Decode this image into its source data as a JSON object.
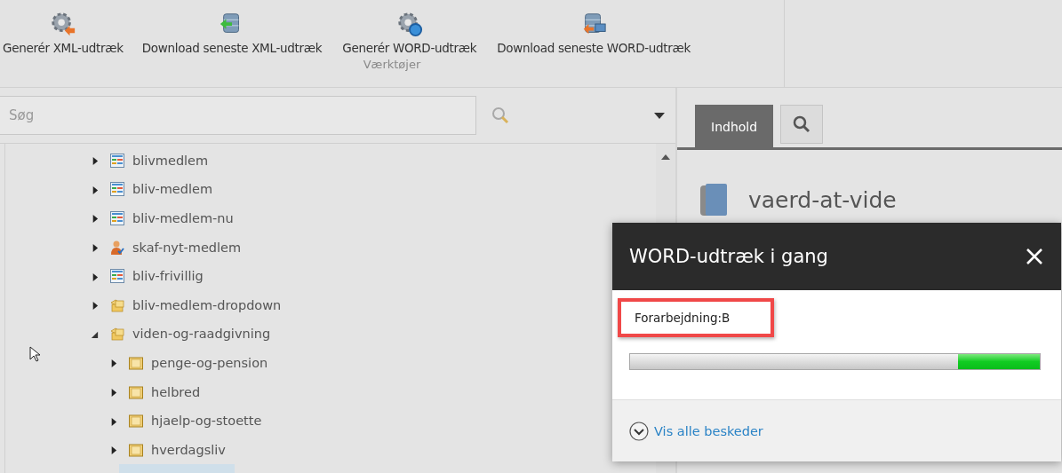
{
  "ribbon": {
    "buttons": [
      {
        "label": "Generér XML-udtræk"
      },
      {
        "label": "Download seneste XML-udtræk"
      },
      {
        "label": "Generér WORD-udtræk"
      },
      {
        "label": "Download seneste WORD-udtræk"
      }
    ],
    "group_label": "Værktøjer"
  },
  "search": {
    "placeholder": "Søg"
  },
  "tree": [
    {
      "label": "blivmedlem",
      "kind": "page",
      "expanded": false
    },
    {
      "label": "bliv-medlem",
      "kind": "page",
      "expanded": false
    },
    {
      "label": "bliv-medlem-nu",
      "kind": "page",
      "expanded": false
    },
    {
      "label": "skaf-nyt-medlem",
      "kind": "person",
      "expanded": false
    },
    {
      "label": "bliv-frivillig",
      "kind": "page",
      "expanded": false
    },
    {
      "label": "bliv-medlem-dropdown",
      "kind": "group",
      "expanded": false
    },
    {
      "label": "viden-og-raadgivning",
      "kind": "group",
      "expanded": true,
      "children": [
        {
          "label": "penge-og-pension",
          "kind": "folder",
          "expanded": false
        },
        {
          "label": "helbred",
          "kind": "folder",
          "expanded": false
        },
        {
          "label": "hjaelp-og-stoette",
          "kind": "folder",
          "expanded": false
        },
        {
          "label": "hverdagsliv",
          "kind": "folder",
          "expanded": false
        }
      ]
    }
  ],
  "content": {
    "tabs": [
      {
        "label": "Indhold",
        "kind": "text",
        "selected": true
      },
      {
        "kind": "search",
        "selected": false
      }
    ],
    "item_title": "vaerd-at-vide"
  },
  "dialog": {
    "title": "WORD-udtræk i gang",
    "message": "Forarbejdning:B",
    "highlighted": true,
    "progress": {
      "level": 0.2
    },
    "link": "Vis alle beskeder"
  }
}
